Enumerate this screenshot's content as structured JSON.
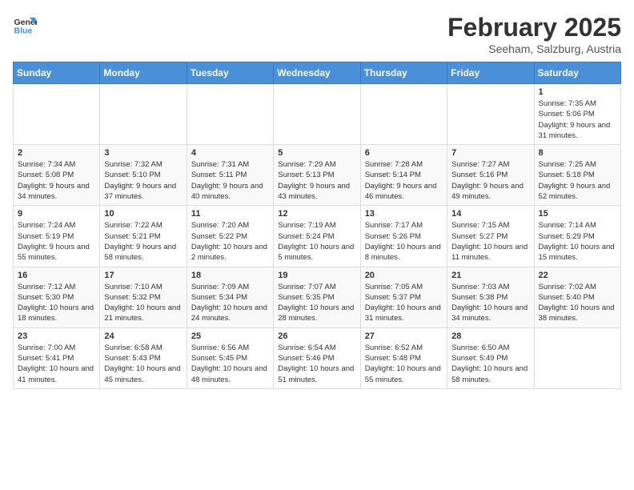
{
  "header": {
    "logo": {
      "general": "General",
      "blue": "Blue"
    },
    "title": "February 2025",
    "subtitle": "Seeham, Salzburg, Austria"
  },
  "weekdays": [
    "Sunday",
    "Monday",
    "Tuesday",
    "Wednesday",
    "Thursday",
    "Friday",
    "Saturday"
  ],
  "weeks": [
    [
      null,
      null,
      null,
      null,
      null,
      null,
      {
        "day": "1",
        "sunrise": "7:35 AM",
        "sunset": "5:06 PM",
        "daylight": "9 hours and 31 minutes."
      }
    ],
    [
      {
        "day": "2",
        "sunrise": "7:34 AM",
        "sunset": "5:08 PM",
        "daylight": "9 hours and 34 minutes."
      },
      {
        "day": "3",
        "sunrise": "7:32 AM",
        "sunset": "5:10 PM",
        "daylight": "9 hours and 37 minutes."
      },
      {
        "day": "4",
        "sunrise": "7:31 AM",
        "sunset": "5:11 PM",
        "daylight": "9 hours and 40 minutes."
      },
      {
        "day": "5",
        "sunrise": "7:29 AM",
        "sunset": "5:13 PM",
        "daylight": "9 hours and 43 minutes."
      },
      {
        "day": "6",
        "sunrise": "7:28 AM",
        "sunset": "5:14 PM",
        "daylight": "9 hours and 46 minutes."
      },
      {
        "day": "7",
        "sunrise": "7:27 AM",
        "sunset": "5:16 PM",
        "daylight": "9 hours and 49 minutes."
      },
      {
        "day": "8",
        "sunrise": "7:25 AM",
        "sunset": "5:18 PM",
        "daylight": "9 hours and 52 minutes."
      }
    ],
    [
      {
        "day": "9",
        "sunrise": "7:24 AM",
        "sunset": "5:19 PM",
        "daylight": "9 hours and 55 minutes."
      },
      {
        "day": "10",
        "sunrise": "7:22 AM",
        "sunset": "5:21 PM",
        "daylight": "9 hours and 58 minutes."
      },
      {
        "day": "11",
        "sunrise": "7:20 AM",
        "sunset": "5:22 PM",
        "daylight": "10 hours and 2 minutes."
      },
      {
        "day": "12",
        "sunrise": "7:19 AM",
        "sunset": "5:24 PM",
        "daylight": "10 hours and 5 minutes."
      },
      {
        "day": "13",
        "sunrise": "7:17 AM",
        "sunset": "5:26 PM",
        "daylight": "10 hours and 8 minutes."
      },
      {
        "day": "14",
        "sunrise": "7:15 AM",
        "sunset": "5:27 PM",
        "daylight": "10 hours and 11 minutes."
      },
      {
        "day": "15",
        "sunrise": "7:14 AM",
        "sunset": "5:29 PM",
        "daylight": "10 hours and 15 minutes."
      }
    ],
    [
      {
        "day": "16",
        "sunrise": "7:12 AM",
        "sunset": "5:30 PM",
        "daylight": "10 hours and 18 minutes."
      },
      {
        "day": "17",
        "sunrise": "7:10 AM",
        "sunset": "5:32 PM",
        "daylight": "10 hours and 21 minutes."
      },
      {
        "day": "18",
        "sunrise": "7:09 AM",
        "sunset": "5:34 PM",
        "daylight": "10 hours and 24 minutes."
      },
      {
        "day": "19",
        "sunrise": "7:07 AM",
        "sunset": "5:35 PM",
        "daylight": "10 hours and 28 minutes."
      },
      {
        "day": "20",
        "sunrise": "7:05 AM",
        "sunset": "5:37 PM",
        "daylight": "10 hours and 31 minutes."
      },
      {
        "day": "21",
        "sunrise": "7:03 AM",
        "sunset": "5:38 PM",
        "daylight": "10 hours and 34 minutes."
      },
      {
        "day": "22",
        "sunrise": "7:02 AM",
        "sunset": "5:40 PM",
        "daylight": "10 hours and 38 minutes."
      }
    ],
    [
      {
        "day": "23",
        "sunrise": "7:00 AM",
        "sunset": "5:41 PM",
        "daylight": "10 hours and 41 minutes."
      },
      {
        "day": "24",
        "sunrise": "6:58 AM",
        "sunset": "5:43 PM",
        "daylight": "10 hours and 45 minutes."
      },
      {
        "day": "25",
        "sunrise": "6:56 AM",
        "sunset": "5:45 PM",
        "daylight": "10 hours and 48 minutes."
      },
      {
        "day": "26",
        "sunrise": "6:54 AM",
        "sunset": "5:46 PM",
        "daylight": "10 hours and 51 minutes."
      },
      {
        "day": "27",
        "sunrise": "6:52 AM",
        "sunset": "5:48 PM",
        "daylight": "10 hours and 55 minutes."
      },
      {
        "day": "28",
        "sunrise": "6:50 AM",
        "sunset": "5:49 PM",
        "daylight": "10 hours and 58 minutes."
      },
      null
    ]
  ]
}
